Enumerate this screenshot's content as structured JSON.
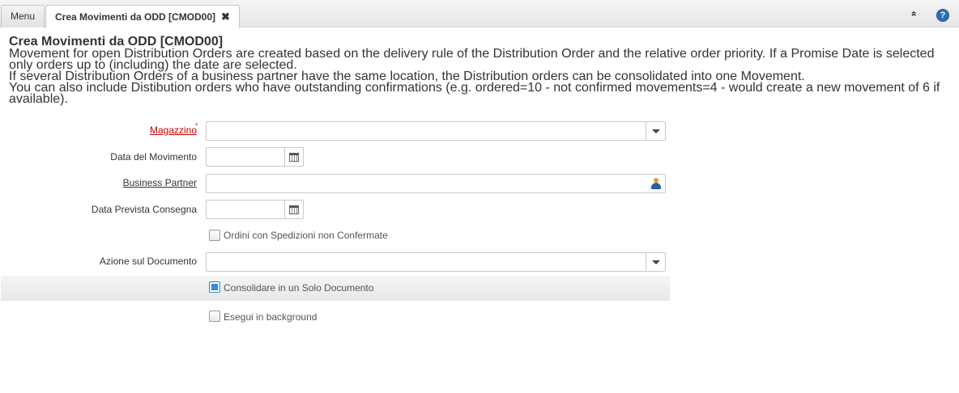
{
  "tabs": {
    "menu_label": "Menu",
    "active_label": "Crea Movimenti da ODD [CMOD00]",
    "close_glyph": "✖"
  },
  "toolbar": {
    "collapse_glyph": "»",
    "help_glyph": "?"
  },
  "process": {
    "title": "Crea Movimenti da ODD [CMOD00]",
    "description": [
      "Movement for open Distribution Orders are created based on the delivery rule of the Distribution Order and the relative order priority. If a Promise Date is selected only orders up to (including) the date are selected.",
      "If several Distribution Orders of a business partner have the same location, the Distribution orders can be consolidated into one Movement.",
      "You can also include Distibution orders who have outstanding confirmations (e.g. ordered=10 - not confirmed movements=4 - would create a new movement of 6 if available)."
    ]
  },
  "form": {
    "warehouse": {
      "label": "Magazzino",
      "required_mark": "*",
      "value": ""
    },
    "movement_date": {
      "label": "Data del Movimento",
      "value": ""
    },
    "business_partner": {
      "label": "Business Partner",
      "value": ""
    },
    "promise_date": {
      "label": "Data Prevista Consegna",
      "value": ""
    },
    "unconfirmed": {
      "label": "Ordini con Spedizioni non Confermate",
      "checked": false
    },
    "doc_action": {
      "label": "Azione sul Documento",
      "value": ""
    },
    "consolidate": {
      "label": "Consolidare in un Solo Documento",
      "checked": true
    },
    "background": {
      "label": "Esegui in background",
      "checked": false
    }
  },
  "colors": {
    "mandatory_label": "#cc0000",
    "checkbox_checked": "#3a8bd6",
    "help_icon": "#2a6fb4"
  }
}
